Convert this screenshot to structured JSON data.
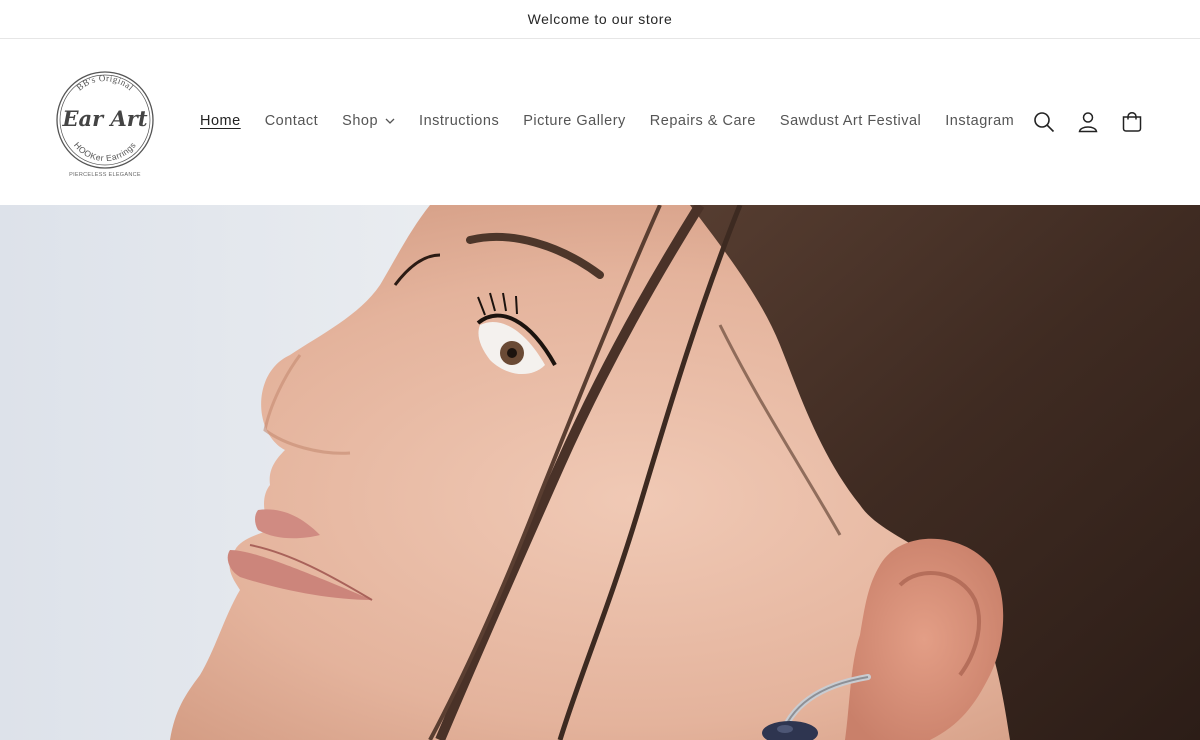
{
  "announcement": {
    "text": "Welcome to our store"
  },
  "logo": {
    "top_text": "BB's Original",
    "main_text": "Ear Art",
    "bottom_text": "HOOKer Earrings",
    "tagline": "PIERCELESS ELEGANCE"
  },
  "nav": {
    "items": [
      {
        "label": "Home",
        "active": true
      },
      {
        "label": "Contact"
      },
      {
        "label": "Shop",
        "has_dropdown": true
      },
      {
        "label": "Instructions"
      },
      {
        "label": "Picture Gallery"
      },
      {
        "label": "Repairs & Care"
      },
      {
        "label": "Sawdust Art Festival"
      },
      {
        "label": "Instagram"
      }
    ]
  },
  "header_icons": [
    "search-icon",
    "account-icon",
    "cart-icon"
  ],
  "hero": {
    "image": "close-up profile of a smiling woman with dark hair wearing a silver ear cuff earring",
    "colors": {
      "background": "#e3e7ed",
      "skin": "#e6b9a3",
      "hair": "#4a3328"
    }
  }
}
